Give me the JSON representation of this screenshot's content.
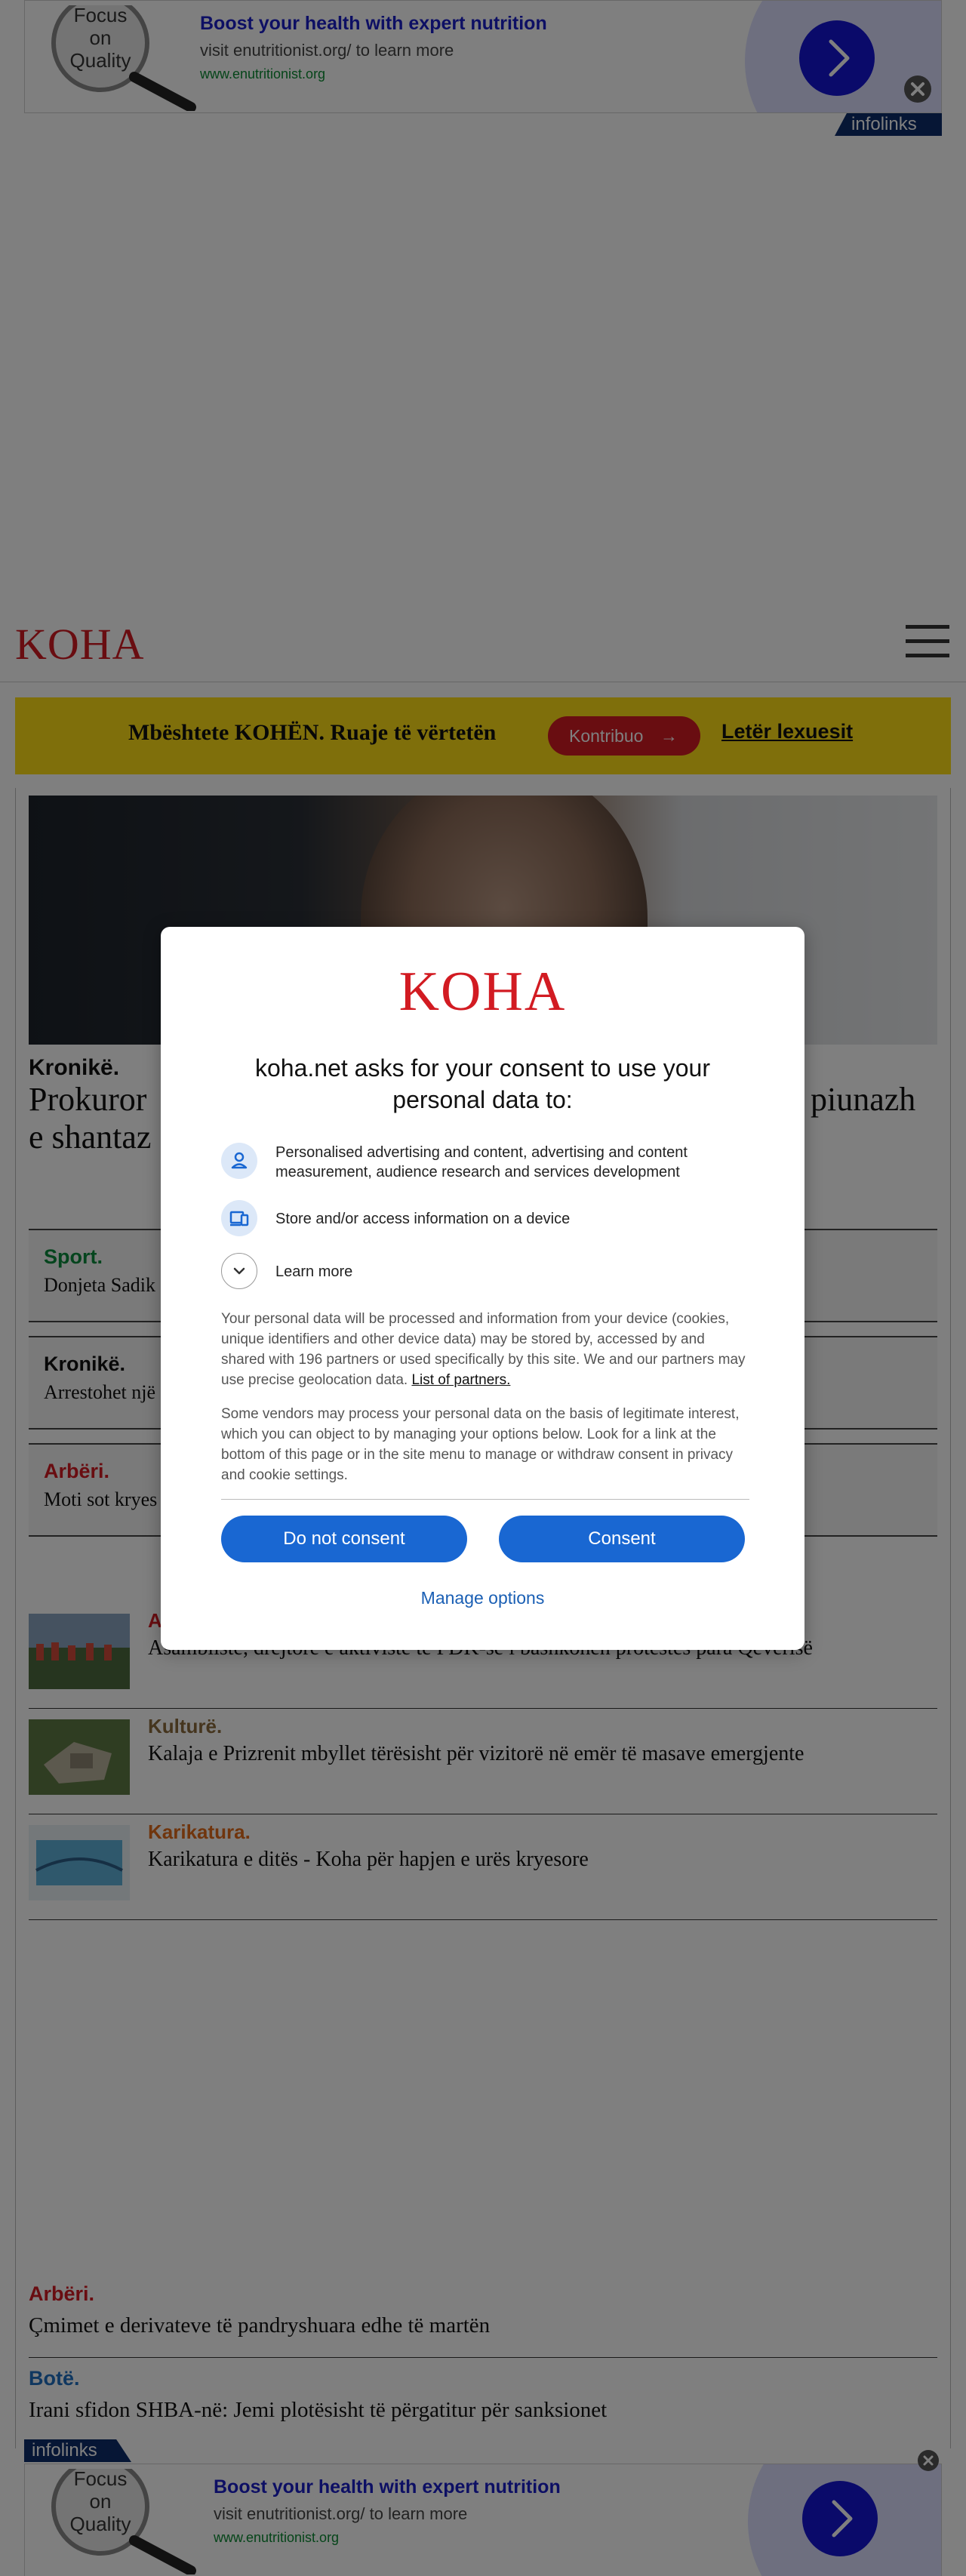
{
  "ad": {
    "logo_text": [
      "Focus",
      "on",
      "Quality"
    ],
    "title": "Boost your health with expert nutrition",
    "description": "visit enutritionist.org/ to learn more",
    "url": "www.enutritionist.org",
    "badge": "infolinks",
    "colors": {
      "title": "#1a1ec9",
      "url": "#0a8a32",
      "arrow": "#1414d4"
    }
  },
  "header": {
    "logo": "KOHA"
  },
  "support": {
    "text": "Mbështete KOHËN. Ruaje të vërtetën",
    "button": "Kontribuo",
    "link": "Letër lexuesit"
  },
  "hero": {
    "category": "Kronikë.",
    "title_left_1": "Prokuror",
    "title_right_1": "piunazh",
    "title_left_2": "e shantaz"
  },
  "cards": [
    {
      "category": "Sport.",
      "text": "Donjeta Sadik",
      "color": "#0a8a3c"
    },
    {
      "category": "Kronikë.",
      "text": "Arrestohet një",
      "color": "#111111"
    },
    {
      "category": "Arbëri.",
      "text": "Moti sot kryes",
      "color": "#d21b22"
    }
  ],
  "rows": [
    {
      "category": "A",
      "title": "Asamblistë, drejtore e aktivistë të PDK-së i bashkohen protestës para Qeverisë",
      "color": "#d21b22"
    },
    {
      "category": "Kulturë.",
      "title": "Kalaja e Prizrenit mbyllet tërësisht për vizitorë në emër të masave emergjente",
      "color": "#8b6b3d"
    },
    {
      "category": "Karikatura.",
      "title": "Karikatura e ditës - Koha për hapjen e urës kryesore",
      "color": "#e06a1b"
    }
  ],
  "list": [
    {
      "category": "Arbëri.",
      "title": "Çmimet e derivateve të pandryshuara edhe të martën",
      "color": "#d21b22"
    },
    {
      "category": "Botë.",
      "title": "Irani sfidon SHBA-në: Jemi plotësisht të përgatitur për sanksionet",
      "color": "#1f6fc0"
    }
  ],
  "consent": {
    "logo": "KOHA",
    "title": "koha.net asks for your consent to use your personal data to:",
    "purposes": [
      {
        "icon": "person-icon",
        "text": "Personalised advertising and content, advertising and content measurement, audience research and services development"
      },
      {
        "icon": "device-icon",
        "text": "Store and/or access information on a device"
      },
      {
        "icon": "chevron-down-icon",
        "text": "Learn more"
      }
    ],
    "paragraph1": "Your personal data will be processed and information from your device (cookies, unique identifiers and other device data) may be stored by, accessed by and shared with 196 partners or used specifically by this site. We and our partners may use precise geolocation data.",
    "partners_link": "List of partners.",
    "paragraph2": "Some vendors may process your personal data on the basis of legitimate interest, which you can object to by managing your options below. Look for a link at the bottom of this page or in the site menu to manage or withdraw consent in privacy and cookie settings.",
    "btn_no": "Do not consent",
    "btn_yes": "Consent",
    "manage": "Manage options",
    "accent": "#1967d2"
  }
}
